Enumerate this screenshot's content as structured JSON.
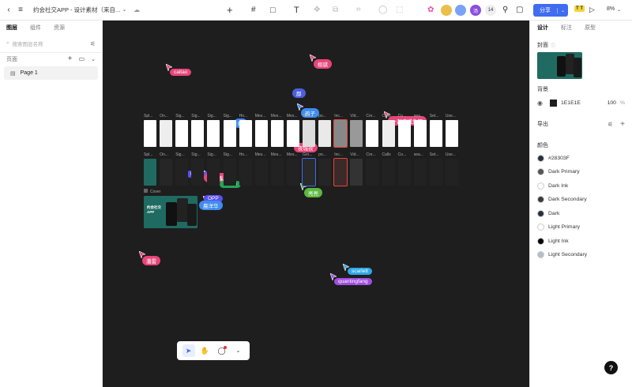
{
  "topbar": {
    "doc_title": "约会社交APP - 设计素材（来自...",
    "collaborator_count": "14",
    "share_label": "分享",
    "zoom": "8%",
    "avatars": [
      {
        "text": "",
        "color": "#e8c04a"
      },
      {
        "text": "",
        "color": "#7aa2f7"
      },
      {
        "text": "汤",
        "color": "#8a4fe0"
      }
    ]
  },
  "left_panel": {
    "tabs": [
      "图层",
      "组件",
      "资源"
    ],
    "search_placeholder": "搜索图层名称",
    "pages_label": "页面",
    "pages": [
      "Page 1"
    ]
  },
  "canvas": {
    "row1_labels": [
      "Spl...",
      "On...",
      "Sig...",
      "Sig...",
      "Sig...",
      "Sig...",
      "Ho...",
      "Mes...",
      "Mes...",
      "Mes...",
      "Gro...",
      "po...",
      "Inc...",
      "Vid...",
      "Cre...",
      "Calls",
      "Co...",
      "sea...",
      "Set...",
      "Use..."
    ],
    "row2_labels": [
      "Spl...",
      "On...",
      "Sig...",
      "Sig...",
      "Sig...",
      "Sig...",
      "Ho...",
      "Mes...",
      "Mes...",
      "Mes...",
      "Gro...",
      "po...",
      "Inc...",
      "Vid...",
      "Cre...",
      "Calls",
      "Co...",
      "sea...",
      "Set...",
      "Use..."
    ],
    "cover_label": "Cover",
    "cover_title": "约会社交APP",
    "cursors": [
      {
        "name": "caitao",
        "color": "#e8457a"
      },
      {
        "name": "栩骐",
        "color": "#e8457a"
      },
      {
        "name": "鄙",
        "color": "#4c5fe0"
      },
      {
        "name": "鹃子",
        "color": "#3f8cf0"
      },
      {
        "name": "晒",
        "color": "#3f8cf0"
      },
      {
        "name": "一起来摸鱼吧",
        "color": "#e8457a"
      },
      {
        "name": "夜城夜",
        "color": "#e8457a"
      },
      {
        "name": "Piaoo",
        "color": "#5a4ff0"
      },
      {
        "name": "丁克善",
        "color": "#e8457a"
      },
      {
        "name": "Halee",
        "color": "#23a455"
      },
      {
        "name": "OPP",
        "color": "#5a4ff0"
      },
      {
        "name": "晨洋华",
        "color": "#3f8cf0"
      },
      {
        "name": "亮亮",
        "color": "#5cb83f"
      },
      {
        "name": "潘雷",
        "color": "#e8457a"
      },
      {
        "name": "scarlett",
        "color": "#2fa8e8"
      },
      {
        "name": "quantingfang",
        "color": "#a04fe0"
      }
    ]
  },
  "right_panel": {
    "tabs": [
      "设计",
      "标注",
      "原型"
    ],
    "cover_label": "封面",
    "background_label": "背景",
    "background_hex": "1E1E1E",
    "background_opacity": "100",
    "background_unit": "%",
    "export_label": "导出",
    "colors_label": "颜色",
    "colors": [
      {
        "name": "#28303F",
        "hex": "#28303F"
      },
      {
        "name": "Dark Primary",
        "hex": "#555555"
      },
      {
        "name": "Dark Ink",
        "hex": "#ffffff"
      },
      {
        "name": "Dark Secondary",
        "hex": "#3a3a3a"
      },
      {
        "name": "Dark",
        "hex": "#28303F"
      },
      {
        "name": "Light Primary",
        "hex": "#ffffff"
      },
      {
        "name": "Light Ink",
        "hex": "#000000"
      },
      {
        "name": "Light Secondary",
        "hex": "#b8bcc8"
      }
    ]
  }
}
